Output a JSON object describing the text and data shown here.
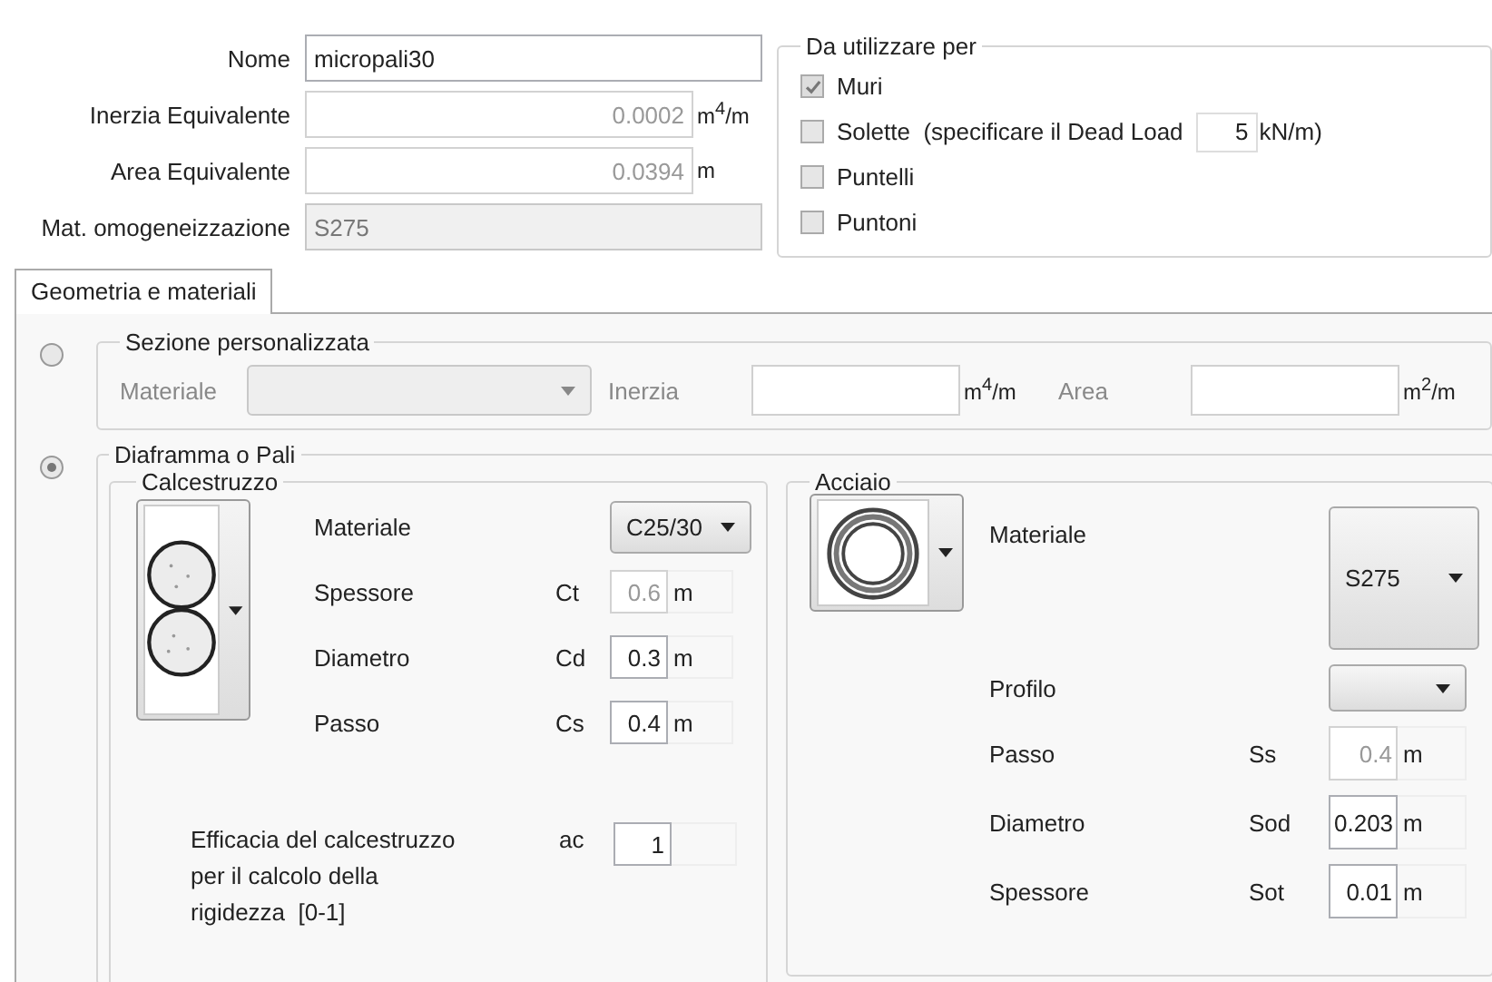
{
  "form": {
    "fields": [
      {
        "label": "Nome",
        "value": "micropali30",
        "kind": "text"
      },
      {
        "label": "Inerzia Equivalente",
        "value": "0.0002",
        "unit": "m$^{4}$/m",
        "kind": "number"
      },
      {
        "label": "Area Equivalente",
        "value": "0.0394",
        "unit": "m",
        "kind": "number"
      },
      {
        "label": "Mat. omogeneizzazione",
        "value": "S275",
        "kind": "locked"
      }
    ]
  },
  "usage": {
    "title": "Da utilizzare per",
    "options": [
      {
        "label": "Muri",
        "checked": true
      },
      {
        "label": "Solette  (specificare il Dead Load",
        "checked": false,
        "value": "5",
        "unit": "kN/m)"
      },
      {
        "label": "Puntelli",
        "checked": false
      },
      {
        "label": "Puntoni",
        "checked": false
      }
    ]
  },
  "tabs": [
    {
      "label": "Geometria e materiali",
      "selected": true
    }
  ],
  "sections": [
    {
      "kind": "custom",
      "title": "Sezione personalizzata",
      "selected": false,
      "material_label": "Materiale",
      "inertia_label": "Inerzia",
      "inertia_unit": "m$^{4}$/m",
      "area_label": "Area",
      "area_unit": "m$^{2}$/m"
    },
    {
      "kind": "piles",
      "title": "Diaframma o Pali",
      "selected": true,
      "concrete": {
        "title": "Calcestruzzo",
        "material_label": "Materiale",
        "material": "C25/30",
        "rows": [
          {
            "label": "Spessore",
            "symbol": "Ct",
            "value": "0.6",
            "unit": "m",
            "disabled": true
          },
          {
            "label": "Diametro",
            "symbol": "Cd",
            "value": "0.3",
            "unit": "m",
            "disabled": false
          },
          {
            "label": "Passo",
            "symbol": "Cs",
            "value": "0.4",
            "unit": "m",
            "disabled": false
          }
        ],
        "efficacy": {
          "label": "Efficacia del calcestruzzo per il calcolo della rigidezza  [0-1]",
          "symbol": "ac",
          "value": "1"
        }
      },
      "steel": {
        "title": "Acciaio",
        "material_label": "Materiale",
        "material": "S275",
        "profile_label": "Profilo",
        "rows": [
          {
            "label": "Passo",
            "symbol": "Ss",
            "value": "0.4",
            "unit": "m",
            "disabled": true
          },
          {
            "label": "Diametro",
            "symbol": "Sod",
            "value": "0.203",
            "unit": "m",
            "disabled": false
          },
          {
            "label": "Spessore",
            "symbol": "Sot",
            "value": "0.01",
            "unit": "m",
            "disabled": false
          }
        ]
      }
    }
  ]
}
